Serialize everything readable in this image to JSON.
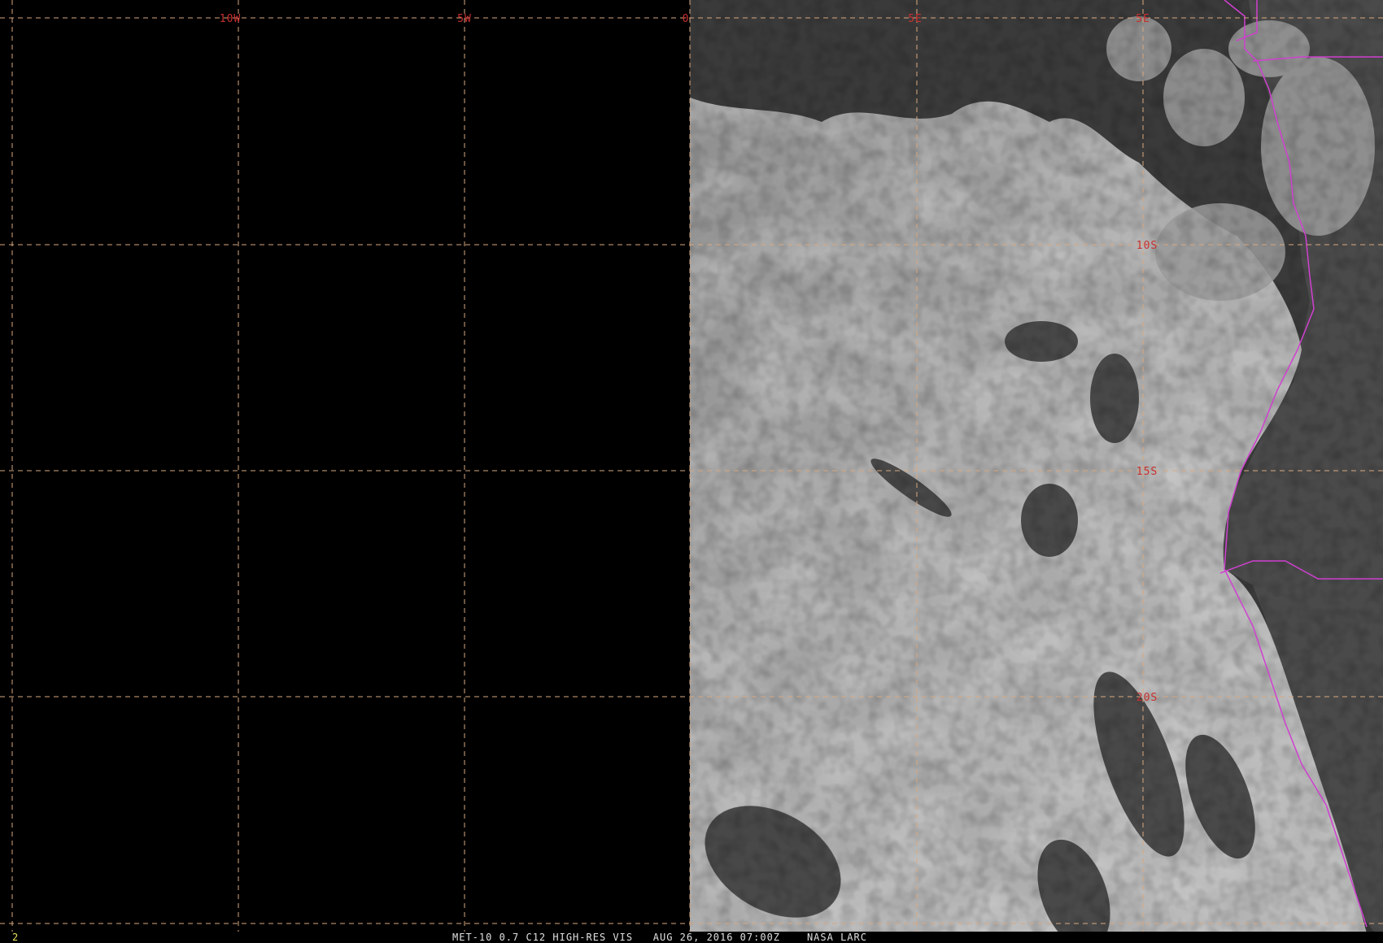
{
  "image": {
    "product": "MET-10 0.7 C12 HIGH-RES VIS",
    "datetime": "AUG 26, 2016 07:00Z",
    "credit": "NASA LARC",
    "frame_number": "2"
  },
  "grid": {
    "line_color": "#d9a880",
    "label_color": "#c83030",
    "longitude_labels": [
      "10W",
      "5W",
      "0",
      "5E",
      "5E"
    ],
    "latitude_labels": [
      "10S",
      "15S",
      "20S"
    ]
  },
  "layers": {
    "no_data_color": "#000000",
    "ocean_color": "#3a3a3a",
    "cloud_color": "#a8a8a8",
    "land_color": "#4a4a4a",
    "border_color": "#d040d0"
  },
  "legend": {}
}
